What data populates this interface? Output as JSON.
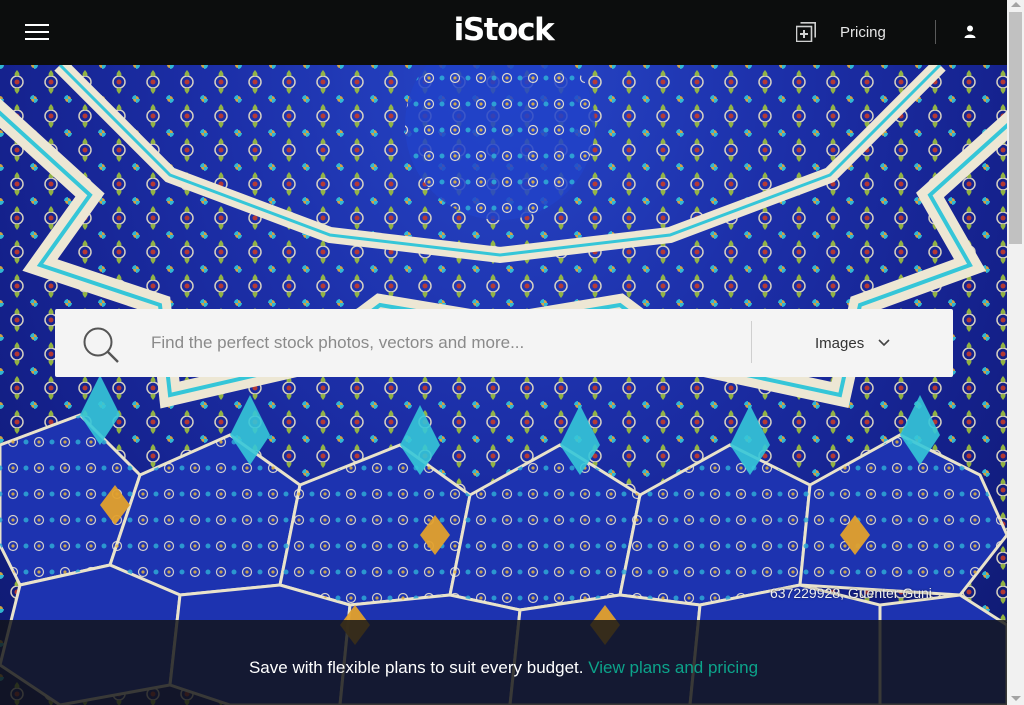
{
  "header": {
    "logo": "iStock",
    "pricing_label": "Pricing",
    "icons": [
      "hamburger-menu-icon",
      "add-to-board-icon",
      "account-icon"
    ]
  },
  "search": {
    "placeholder": "Find the perfect stock photos, vectors and more...",
    "value": "",
    "media_type": "Images",
    "icons": [
      "search-icon",
      "chevron-down-icon"
    ]
  },
  "hero": {
    "credit": "637229928, Guenter Guni"
  },
  "promo": {
    "text": "Save with flexible plans to suit every budget.",
    "link": "View plans and pricing"
  },
  "colors": {
    "header_bg": "#0c0d0d",
    "link_accent": "#0ca38a",
    "tile_blue": "#1f3cc2",
    "tile_turquoise": "#35c6d8"
  }
}
